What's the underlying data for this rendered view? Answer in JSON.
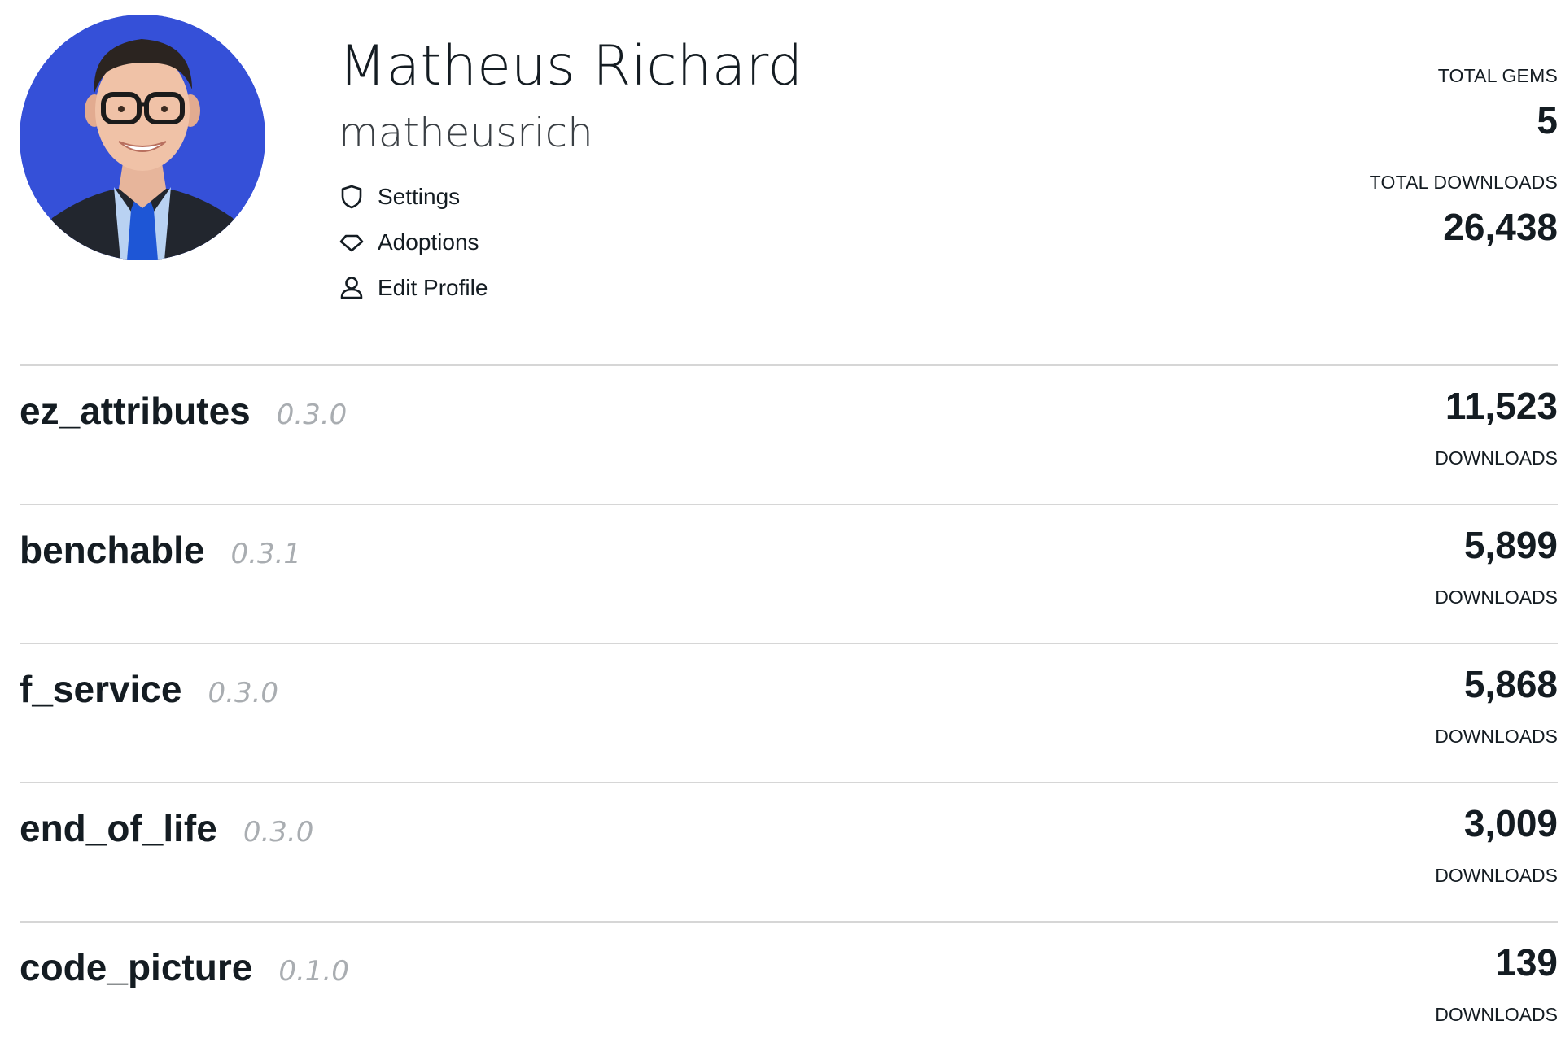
{
  "profile": {
    "full_name": "Matheus Richard",
    "handle": "matheusrich",
    "links": [
      {
        "label": "Settings",
        "icon": "shield-icon"
      },
      {
        "label": "Adoptions",
        "icon": "gem-icon"
      },
      {
        "label": "Edit Profile",
        "icon": "user-icon"
      }
    ]
  },
  "stats": {
    "total_gems_label": "TOTAL GEMS",
    "total_gems_value": "5",
    "total_downloads_label": "TOTAL DOWNLOADS",
    "total_downloads_value": "26,438"
  },
  "gems": [
    {
      "name": "ez_attributes",
      "version": "0.3.0",
      "downloads": "11,523",
      "downloads_label": "DOWNLOADS"
    },
    {
      "name": "benchable",
      "version": "0.3.1",
      "downloads": "5,899",
      "downloads_label": "DOWNLOADS"
    },
    {
      "name": "f_service",
      "version": "0.3.0",
      "downloads": "5,868",
      "downloads_label": "DOWNLOADS"
    },
    {
      "name": "end_of_life",
      "version": "0.3.0",
      "downloads": "3,009",
      "downloads_label": "DOWNLOADS"
    },
    {
      "name": "code_picture",
      "version": "0.1.0",
      "downloads": "139",
      "downloads_label": "DOWNLOADS"
    }
  ],
  "colors": {
    "avatar_background": "#3550d8",
    "text": "#141c22",
    "version_text": "#a9adb1",
    "divider": "#d6d6d6"
  }
}
